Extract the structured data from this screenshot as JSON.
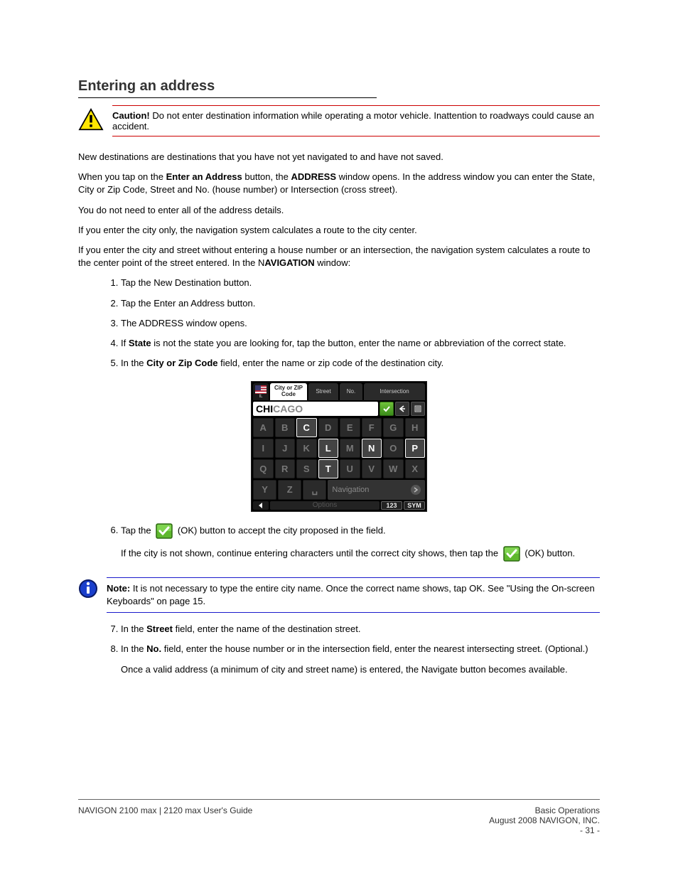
{
  "section": {
    "title": "Entering an address"
  },
  "caution": {
    "lead": "Caution!",
    "text": " Do not enter destination information while operating a motor vehicle. Inattention to roadways could cause an accident."
  },
  "p1": "New destinations are destinations that you have not yet navigated to and have not saved.",
  "p2_a": "When you tap on the ",
  "p2_b": "Enter an Address",
  "p2_c": " button, the ",
  "p2_d": "ADDRESS",
  "p2_e": " window opens. In the address window you can enter the State, City or Zip Code, Street and No. (house number) or Intersection (cross street).",
  "p3": "You do not need to enter all of the address details.",
  "p4": "If you enter the city only, the navigation system calculates a route to the city center.",
  "p5_a": "If you enter the city and street without entering a house number or an intersection, the navigation system calculates a route to the center point of the street entered. In the N",
  "p5_b": "AVIGATION",
  "p5_c": " window:",
  "steps": [
    {
      "text": "Tap the New Destination button."
    },
    {
      "text": "Tap the Enter an Address button."
    },
    {
      "text": "The ADDRESS window opens."
    },
    {
      "text_a": "If ",
      "button": "State",
      "text_b": " is not the state you are looking for, tap the button, enter the name or abbreviation of the correct state."
    },
    {
      "text_a": "In the ",
      "field": "City or Zip Code",
      "text_b": " field, enter the name or zip code of the destination city."
    }
  ],
  "screenshot": {
    "tabs": {
      "flag_caption": "IL",
      "city": "City or ZIP Code",
      "street": "Street",
      "no": "No.",
      "intersection": "Intersection"
    },
    "input_typed": "CHI",
    "input_suggest": "CAGO",
    "keys_row1": [
      "A",
      "B",
      "C",
      "D",
      "E",
      "F",
      "G",
      "H"
    ],
    "keys_row2": [
      "I",
      "J",
      "K",
      "L",
      "M",
      "N",
      "O",
      "P"
    ],
    "keys_row3": [
      "Q",
      "R",
      "S",
      "T",
      "U",
      "V",
      "W",
      "X"
    ],
    "keys_row4": [
      "Y",
      "Z",
      "␣"
    ],
    "available_keys": [
      "C",
      "L",
      "N",
      "P",
      "T"
    ],
    "nav_label": "Navigation",
    "bottom": {
      "options": "Options",
      "num": "123",
      "sym": "SYM"
    }
  },
  "step6": {
    "a": "Tap the ",
    "b": " (OK) button to accept the city proposed in the field.",
    "c": "If the city is not shown, continue entering characters until the correct city shows, then tap the ",
    "d": " (OK) button."
  },
  "note": {
    "lead": "Note:",
    "text": " It is not necessary to type the entire city name. Once the correct name shows, tap OK. See \"Using the On-screen Keyboards\" on page 15."
  },
  "step7": {
    "a": "In the ",
    "field": "Street",
    "b": " field, enter the name of the destination street."
  },
  "step8": {
    "a": "In the ",
    "field": "No.",
    "b": " field, enter the house number or in the intersection field, enter the nearest intersecting street. (Optional.)"
  },
  "p6": "Once a valid address (a minimum of city and street name) is entered, the Navigate button becomes available.",
  "footer": {
    "left": "NAVIGON 2100 max | 2120 max User's Guide",
    "right_a": "Basic Operations",
    "right_b": "August 2008 NAVIGON, INC.",
    "right_c": "- 31 -"
  }
}
